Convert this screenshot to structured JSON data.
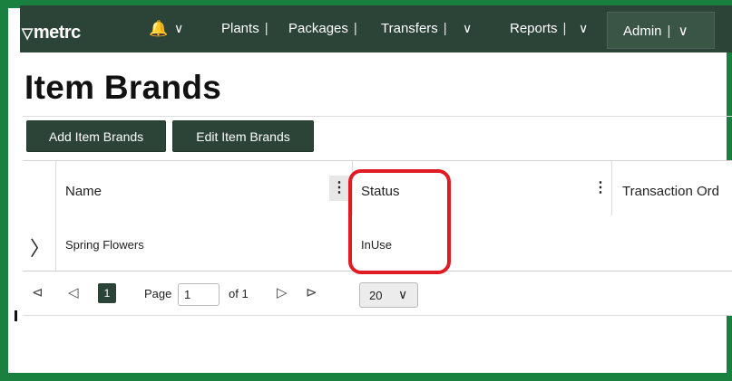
{
  "nav": {
    "logo": "metrc",
    "logo_mark": "▽",
    "bell_glyph": "🔔",
    "chevron_glyph": "∨",
    "separator": "|",
    "items": [
      {
        "label": "Plants"
      },
      {
        "label": "Packages"
      },
      {
        "label": "Transfers"
      },
      {
        "label": "Reports"
      }
    ],
    "admin_label": "Admin"
  },
  "page": {
    "title": "Item Brands"
  },
  "toolbar": {
    "add_label": "Add Item Brands",
    "edit_label": "Edit Item Brands"
  },
  "grid": {
    "columns": [
      {
        "label": "Name"
      },
      {
        "label": "Status"
      },
      {
        "label": "Transaction Ord"
      }
    ],
    "menu_glyph": "⋮",
    "expander_glyph": "〉",
    "rows": [
      {
        "name": "Spring Flowers",
        "status": "InUse"
      }
    ]
  },
  "pager": {
    "first_glyph": "⊲",
    "prev_glyph": "◁",
    "next_glyph": "▷",
    "last_glyph": "⊳",
    "current_page": "1",
    "page_label": "Page",
    "page_value": "1",
    "of_label": "of 1",
    "page_size": "20",
    "chevron_glyph": "∨"
  },
  "colors": {
    "frame": "#1a8040",
    "nav_bg": "#2b4437",
    "highlight": "#e01b24"
  }
}
